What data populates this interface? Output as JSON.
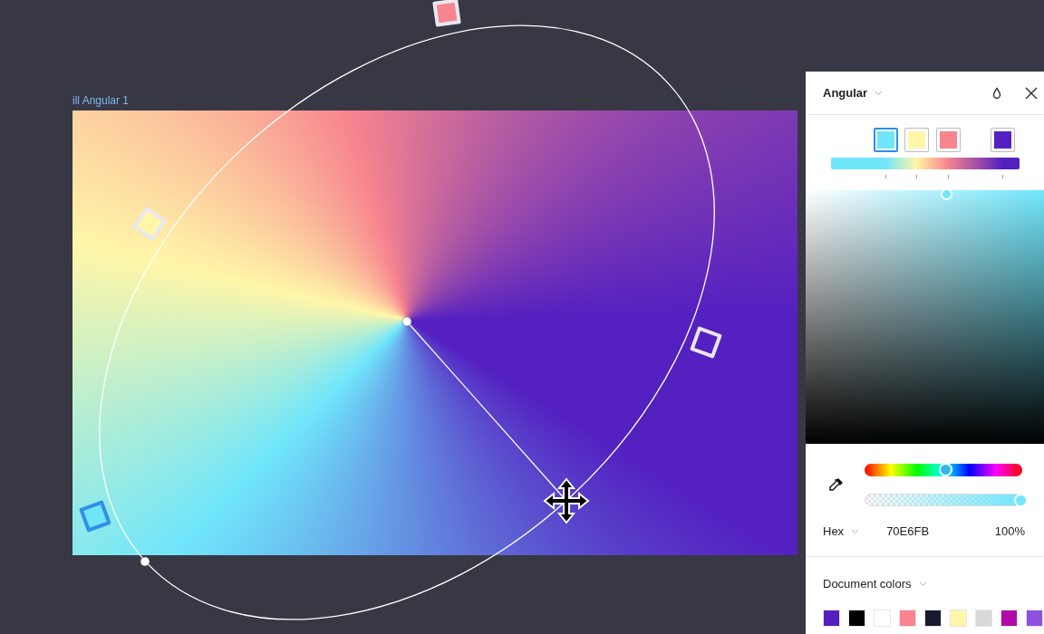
{
  "frame": {
    "label": "ill Angular 1"
  },
  "gradient": {
    "type": "Angular",
    "stops": [
      {
        "color": "#70e6fb",
        "level": 0.29,
        "selected": true
      },
      {
        "color": "#fff6a8",
        "level": 0.45,
        "selected": false
      },
      {
        "color": "#f7848e",
        "level": 0.62,
        "selected": false
      },
      {
        "color": "#5420c0",
        "level": 0.91,
        "selected": false
      }
    ]
  },
  "picker": {
    "hue": {
      "level": 0.52
    },
    "alpha": {
      "level": 1
    },
    "format": "Hex",
    "hex": "70E6FB",
    "opacity": "100%"
  },
  "document_colors": {
    "label": "Document colors",
    "swatches": [
      {
        "color": "#5420c0"
      },
      {
        "color": "#000000"
      },
      {
        "color": "#ffffff"
      },
      {
        "color": "#f7848e"
      },
      {
        "color": "#1a1a2e"
      },
      {
        "color": "#fff6a8"
      },
      {
        "color": "#d9d9d9"
      },
      {
        "color": "#b00ba8"
      },
      {
        "color": "#9050e0"
      }
    ]
  }
}
